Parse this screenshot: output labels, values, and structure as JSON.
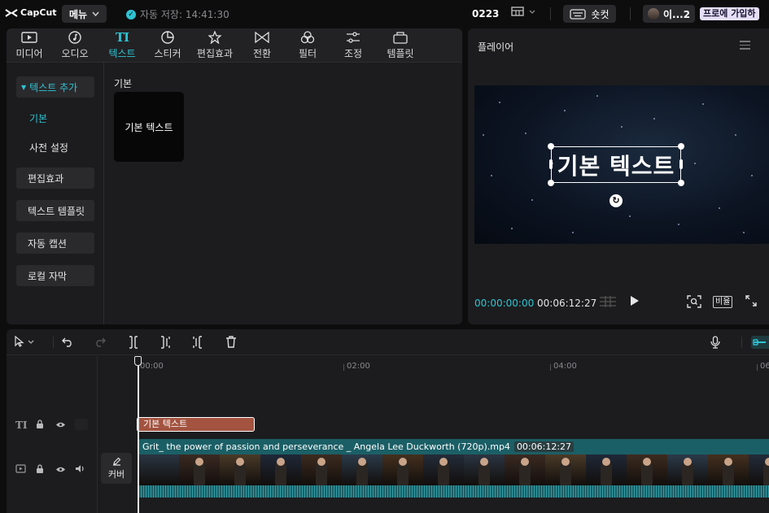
{
  "topbar": {
    "logo_text": "CapCut",
    "menu_label": "메뉴",
    "autosave_text": "자동 저장: 14:41:30",
    "project_name": "0223",
    "shortcut_label": "숏컷",
    "account_name": "이...2",
    "pro_label": "프로에 가입하"
  },
  "tabs": [
    {
      "label": "미디어",
      "icon": "media-icon"
    },
    {
      "label": "오디오",
      "icon": "audio-icon"
    },
    {
      "label": "텍스트",
      "icon": "text-icon",
      "active": true
    },
    {
      "label": "스티커",
      "icon": "sticker-icon"
    },
    {
      "label": "편집효과",
      "icon": "effects-icon"
    },
    {
      "label": "전환",
      "icon": "transition-icon"
    },
    {
      "label": "필터",
      "icon": "filter-icon"
    },
    {
      "label": "조정",
      "icon": "adjust-icon"
    },
    {
      "label": "템플릿",
      "icon": "template-icon"
    }
  ],
  "sidebar": {
    "add_text": "텍스트 추가",
    "basic": "기본",
    "presets": "사전 설정",
    "effects": "편집효과",
    "text_template": "텍스트 템플릿",
    "auto_captions": "자동 캡션",
    "local_captions": "로컬 자막"
  },
  "content": {
    "section_label": "기본",
    "card_label": "기본 텍스트"
  },
  "player": {
    "title": "플레이어",
    "overlay_text": "기본 텍스트",
    "current_time": "00:00:00:00",
    "total_time": "00:06:12:27",
    "ratio_label": "비율"
  },
  "timeline": {
    "ruler": [
      "00:00",
      "02:00",
      "04:00",
      "06"
    ],
    "text_clip_label": "기본 텍스트",
    "video_clip_name": "Grit_ the power of passion and perseverance _ Angela Lee Duckworth (720p).mp4",
    "video_clip_duration": "00:06:12:27",
    "cover_label": "커버"
  },
  "colors": {
    "accent": "#2fc3d3",
    "text_clip": "#a35340",
    "video_clip": "#1b5f66",
    "panel": "#1c1c1e"
  }
}
